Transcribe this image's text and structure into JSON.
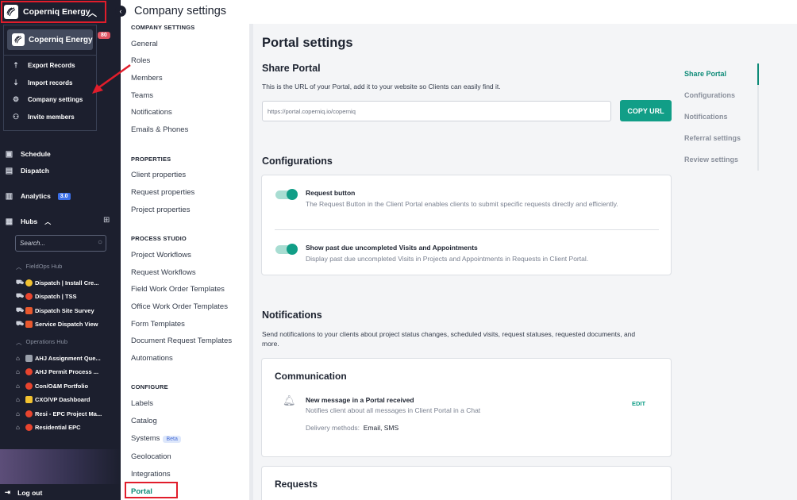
{
  "workspace": {
    "name": "Coperniq Energy",
    "badge": "80"
  },
  "workspace_menu": {
    "header": "Coperniq Energy",
    "items": [
      {
        "label": "Export Records",
        "icon": "upload-icon"
      },
      {
        "label": "Import records",
        "icon": "download-icon"
      },
      {
        "label": "Company settings",
        "icon": "gear-icon"
      },
      {
        "label": "Invite members",
        "icon": "user-plus-icon"
      }
    ]
  },
  "sidebar": {
    "schedule": "Schedule",
    "dispatch": "Dispatch",
    "analytics": "Analytics",
    "analytics_badge": "3.0",
    "hubs": "Hubs",
    "search_placeholder": "Search...",
    "fieldops_label": "FieldOps Hub",
    "fieldops_items": [
      "Dispatch | Install Cre...",
      "Dispatch | TSS",
      "Dispatch Site Survey",
      "Service Dispatch View"
    ],
    "operations_label": "Operations Hub",
    "operations_items": [
      "AHJ Assignment Que...",
      "AHJ Permit Process ...",
      "Con/O&M Portfolio",
      "CXO/VP Dashboard",
      "Resi - EPC Project Ma...",
      "Residential EPC"
    ],
    "logout": "Log out"
  },
  "page_title": "Company settings",
  "settings_menu": {
    "company_settings": "COMPANY SETTINGS",
    "company_items": [
      "General",
      "Roles",
      "Members",
      "Teams",
      "Notifications",
      "Emails & Phones"
    ],
    "properties": "PROPERTIES",
    "properties_items": [
      "Client properties",
      "Request properties",
      "Project properties"
    ],
    "process_studio": "PROCESS STUDIO",
    "process_items": [
      "Project Workflows",
      "Request Workflows",
      "Field Work Order Templates",
      "Office Work Order Templates",
      "Form Templates",
      "Document Request Templates",
      "Automations"
    ],
    "configure": "CONFIGURE",
    "configure_items": [
      "Labels",
      "Catalog",
      "Systems",
      "Geolocation",
      "Integrations",
      "Portal"
    ],
    "beta_label": "Beta"
  },
  "portal": {
    "title": "Portal settings",
    "share_title": "Share Portal",
    "share_desc": "This is the URL of your Portal, add it to your website so Clients can easily find it.",
    "url": "https://portal.coperniq.io/coperniq",
    "copy_button": "COPY URL",
    "config_title": "Configurations",
    "configs": [
      {
        "title": "Request button",
        "desc": "The Request Button in the Client Portal enables clients to submit specific requests directly and efficiently.",
        "enabled": true
      },
      {
        "title": "Show past due uncompleted Visits and Appointments",
        "desc": "Display past due uncompleted Visits in Projects and Appointments in Requests in Client Portal.",
        "enabled": true
      }
    ],
    "notifications_title": "Notifications",
    "notifications_desc": "Send notifications to your clients about project status changes, scheduled visits, request statuses, requested documents, and more.",
    "communication_title": "Communication",
    "message_title": "New message in a Portal received",
    "message_desc": "Notifies client about all messages in Client Portal in a Chat",
    "delivery_label": "Delivery methods:",
    "delivery_value": "Email, SMS",
    "edit_label": "EDIT",
    "requests_title": "Requests"
  },
  "anchors": [
    "Share Portal",
    "Configurations",
    "Notifications",
    "Referral settings",
    "Review settings"
  ],
  "colors": {
    "accent": "#119e87",
    "sidebar": "#1c1f2e",
    "highlight": "#e11d2b"
  }
}
